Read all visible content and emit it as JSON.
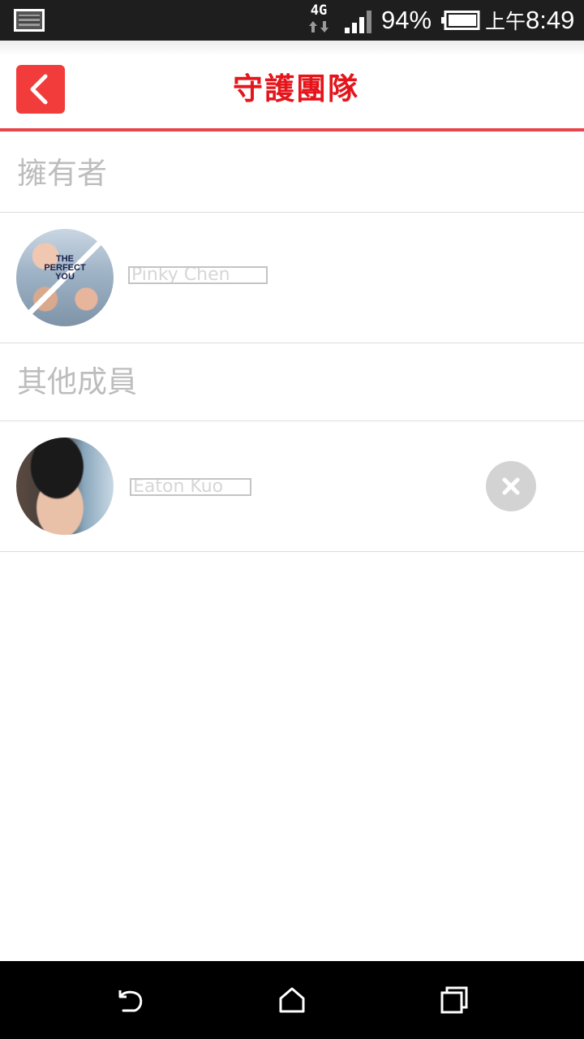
{
  "status_bar": {
    "network": "4G",
    "battery_percent": "94%",
    "time_period": "上午",
    "time": "8:49",
    "icons": [
      "image-notification-icon",
      "network-4g-icon",
      "signal-strength-icon",
      "battery-icon"
    ]
  },
  "header": {
    "title": "守護團隊",
    "back_icon": "chevron-left-icon",
    "accent_color": "#e4161c"
  },
  "sections": {
    "owner": {
      "title": "擁有者",
      "member": {
        "name": "Pinky Chen",
        "avatar_caption": [
          "THE",
          "PERFECT",
          "YOU"
        ]
      }
    },
    "others": {
      "title": "其他成員",
      "members": [
        {
          "name": "Eaton Kuo",
          "remove_icon": "close-icon"
        }
      ]
    }
  },
  "nav_bar": {
    "icons": [
      "back-icon",
      "home-icon",
      "recent-apps-icon"
    ]
  }
}
